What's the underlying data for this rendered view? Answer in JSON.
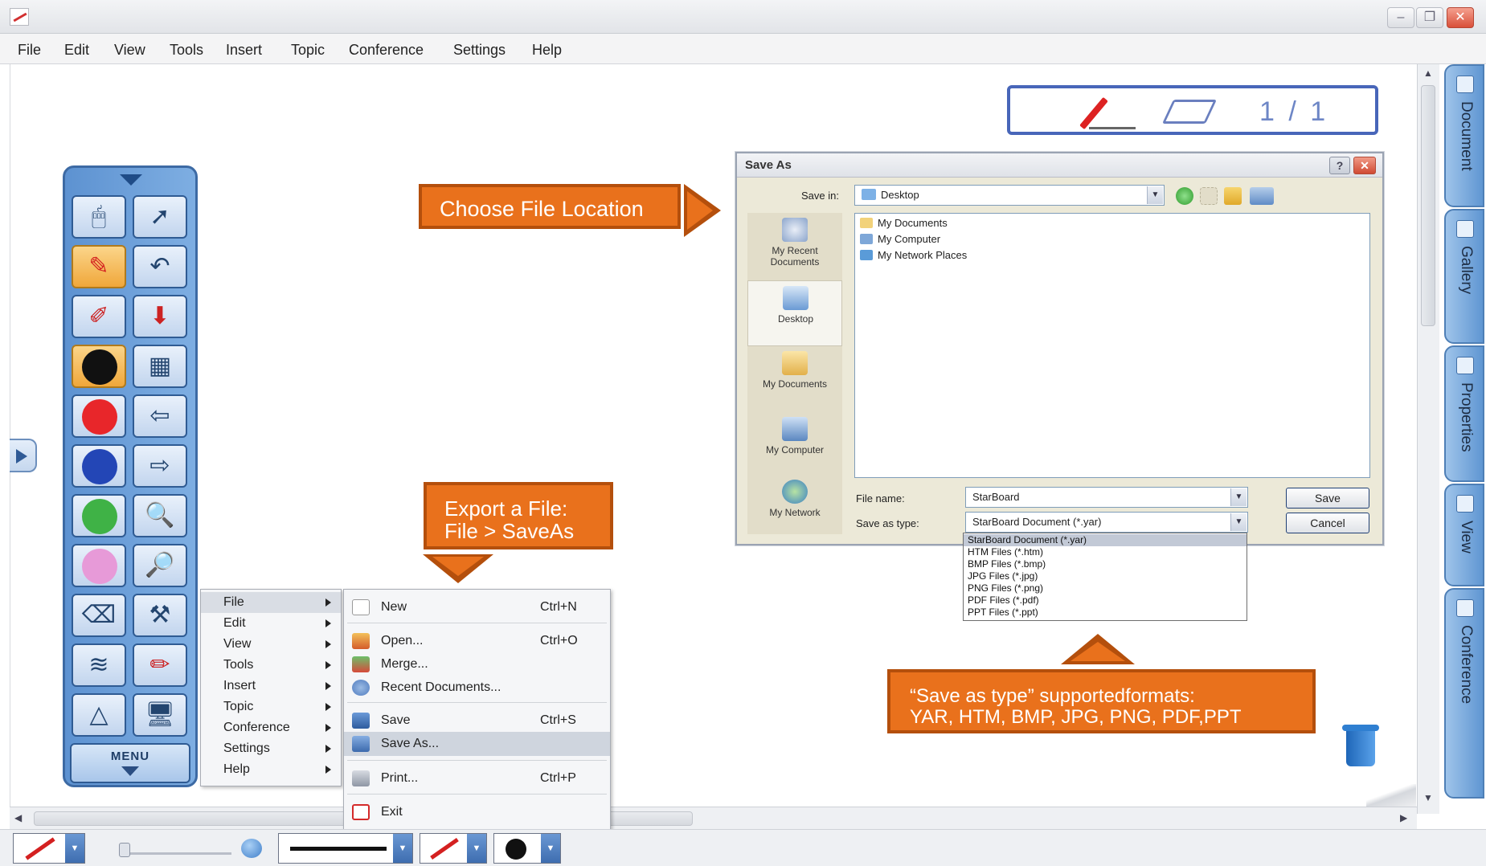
{
  "menubar": [
    "File",
    "Edit",
    "View",
    "Tools",
    "Insert",
    "Topic",
    "Conference",
    "Settings",
    "Help"
  ],
  "window_buttons": [
    "–",
    "❐",
    "✕"
  ],
  "side_tabs": [
    "Document",
    "Gallery",
    "Properties",
    "View",
    "Conference"
  ],
  "page_indicator": "1 / 1",
  "toolbar": {
    "menu_label": "MENU",
    "colors": {
      "black": "#111111",
      "red": "#e8262a",
      "blue": "#2346b6",
      "green": "#3fb246",
      "pink": "#e79ad8"
    }
  },
  "context_menu": {
    "items": [
      "File",
      "Edit",
      "View",
      "Tools",
      "Insert",
      "Topic",
      "Conference",
      "Settings",
      "Help"
    ],
    "file_submenu": [
      {
        "label": "New",
        "shortcut": "Ctrl+N"
      },
      {
        "label": "Open...",
        "shortcut": "Ctrl+O"
      },
      {
        "label": "Merge...",
        "shortcut": ""
      },
      {
        "label": "Recent Documents...",
        "shortcut": ""
      },
      {
        "label": "Save",
        "shortcut": "Ctrl+S"
      },
      {
        "label": "Save As...",
        "shortcut": ""
      },
      {
        "label": "Print...",
        "shortcut": "Ctrl+P"
      },
      {
        "label": "Exit",
        "shortcut": ""
      }
    ]
  },
  "dialog": {
    "title": "Save As",
    "help": "?",
    "close": "✕",
    "save_in_label": "Save in:",
    "save_in_value": "Desktop",
    "places": [
      "My Recent Documents",
      "Desktop",
      "My Documents",
      "My Computer",
      "My Network"
    ],
    "files": [
      "My Documents",
      "My Computer",
      "My Network Places"
    ],
    "file_name_label": "File name:",
    "file_name_value": "StarBoard",
    "save_type_label": "Save as type:",
    "save_type_value": "StarBoard Document (*.yar)",
    "save_button": "Save",
    "cancel_button": "Cancel",
    "type_options": [
      "StarBoard Document (*.yar)",
      "HTM Files (*.htm)",
      "BMP Files (*.bmp)",
      "JPG Files (*.jpg)",
      "PNG Files (*.png)",
      "PDF Files (*.pdf)",
      "PPT Files (*.ppt)"
    ]
  },
  "callouts": {
    "location": "Choose File Location",
    "export_line1": "Export a File:",
    "export_line2": "File > SaveAs",
    "formats_line1": "“Save as type” supportedformats:",
    "formats_line2": "YAR, HTM, BMP, JPG, PNG, PDF,PPT"
  },
  "scroll": {
    "up": "▲",
    "down": "▼",
    "left": "◀",
    "right": "▶"
  },
  "dropdown_glyph": "▼",
  "colors": {
    "accent_orange": "#e9711c",
    "toolbar_blue": "#5d92d1"
  }
}
